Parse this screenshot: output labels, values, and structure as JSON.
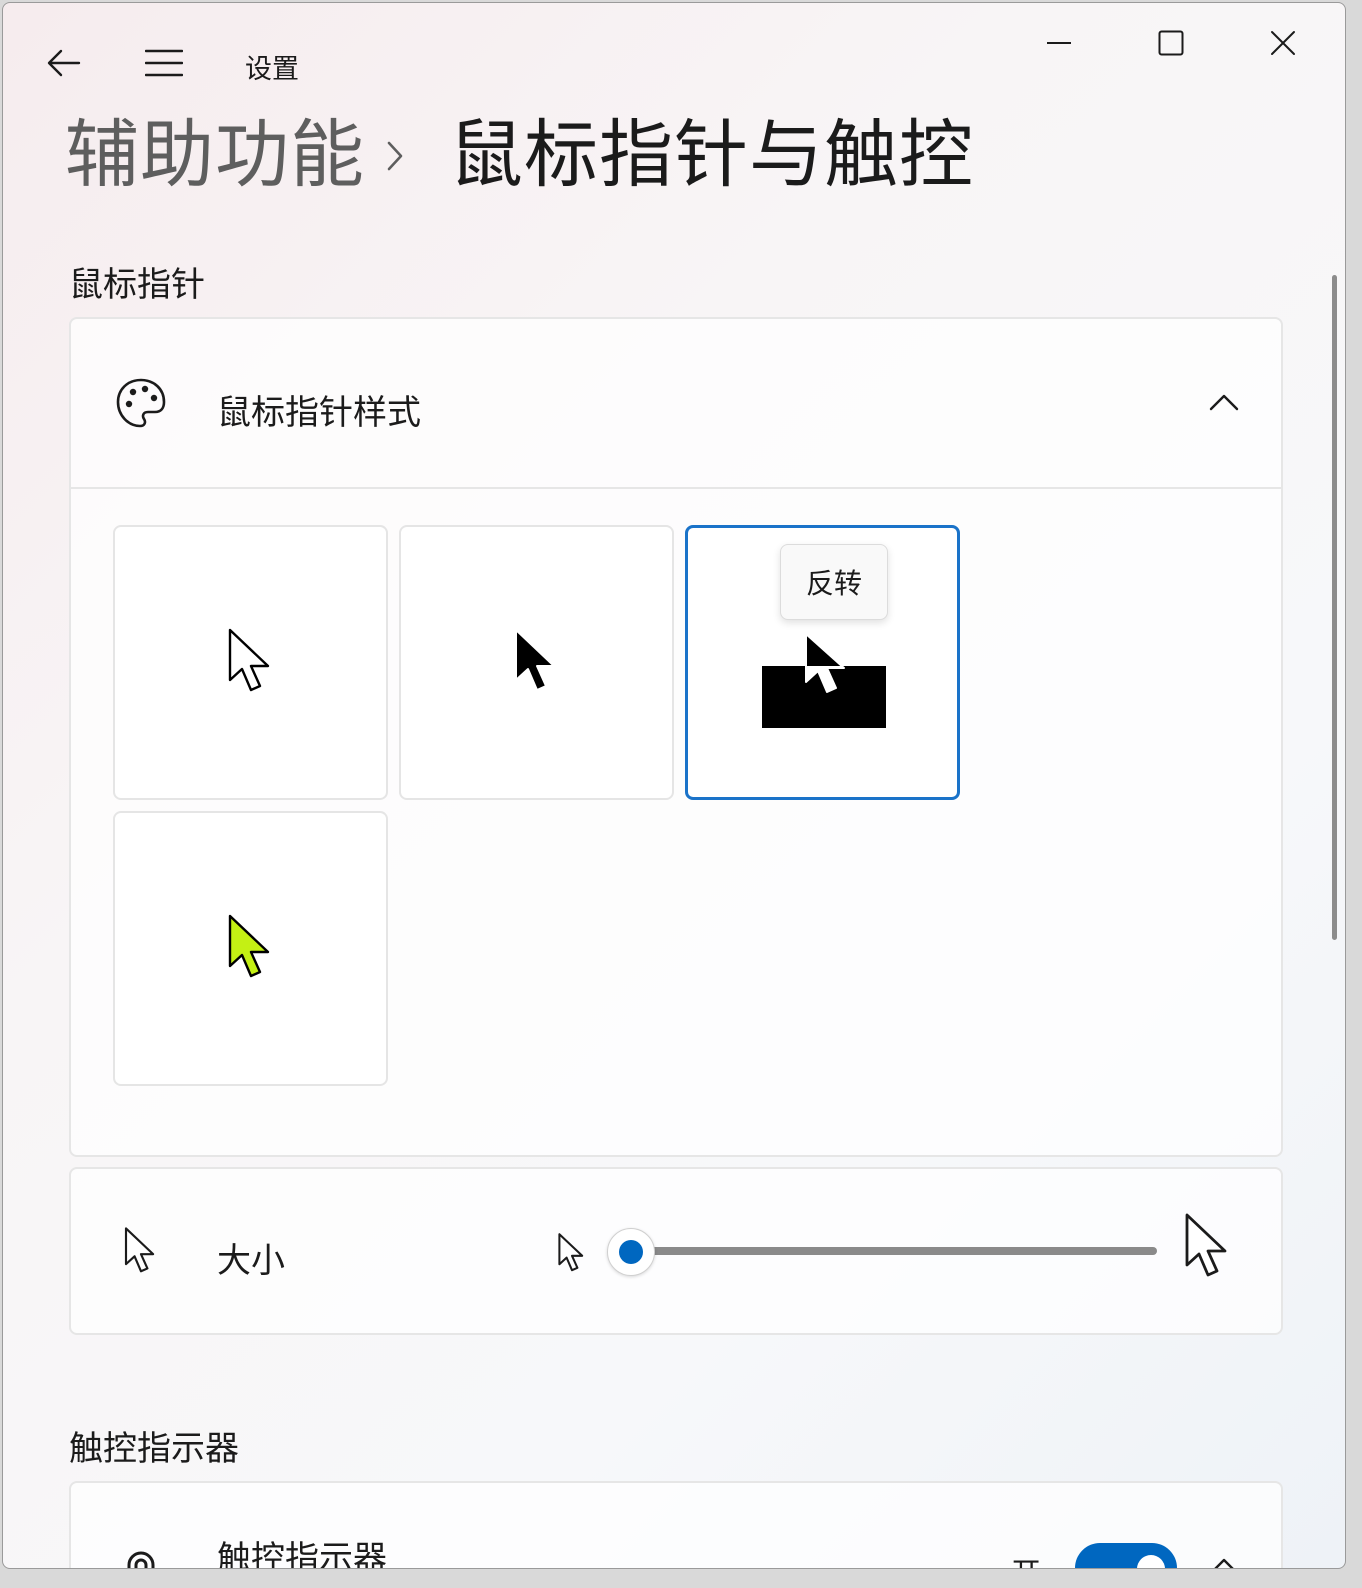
{
  "titlebar": {
    "title": "设置",
    "back_icon": "back-arrow-icon",
    "menu_icon": "hamburger-icon",
    "minimize_icon": "minimize-icon",
    "maximize_icon": "maximize-icon",
    "close_icon": "close-icon"
  },
  "breadcrumb": {
    "parent": "辅助功能",
    "current": "鼠标指针与触控"
  },
  "sections": {
    "mouse_pointer": {
      "header": "鼠标指针",
      "style_card": {
        "title": "鼠标指针样式",
        "icon": "palette-icon",
        "expanded": true,
        "options": [
          {
            "name": "white-pointer",
            "color": "#ffffff",
            "selected": false
          },
          {
            "name": "black-pointer",
            "color": "#000000",
            "selected": false
          },
          {
            "name": "inverted-pointer",
            "color": "inverted",
            "selected": true,
            "tooltip": "反转"
          },
          {
            "name": "custom-pointer",
            "color": "#c4f014",
            "selected": false
          }
        ]
      },
      "size_row": {
        "label": "大小",
        "slider_value_fraction": 0.0
      }
    },
    "touch_indicator": {
      "header": "触控指示器",
      "card": {
        "title": "触控指示器",
        "state_label": "开",
        "toggle_on": true
      }
    }
  },
  "colors": {
    "accent": "#0067c0",
    "selected_border": "#1a73c9",
    "custom_pointer": "#c4f014"
  }
}
